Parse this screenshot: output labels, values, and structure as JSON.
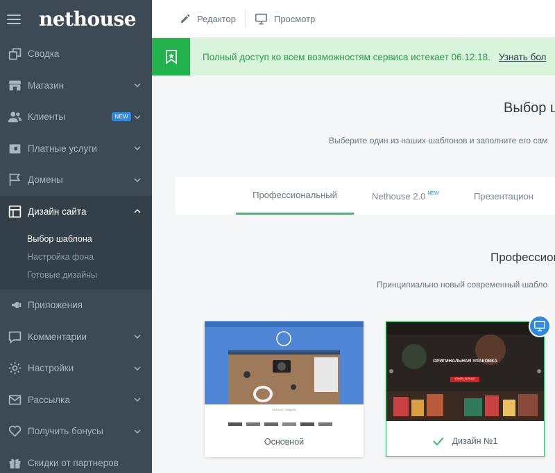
{
  "app": {
    "logo": "nethouse"
  },
  "sidebar": {
    "items": [
      {
        "label": "Сводка",
        "icon": "copy-icon"
      },
      {
        "label": "Магазин",
        "icon": "store-icon"
      },
      {
        "label": "Клиенты",
        "icon": "users-icon",
        "badge": "NEW"
      },
      {
        "label": "Платные услуги",
        "icon": "wallet-icon"
      },
      {
        "label": "Домены",
        "icon": "flag-icon"
      },
      {
        "label": "Дизайн сайта",
        "icon": "layout-icon"
      },
      {
        "label": "Приложения",
        "icon": "plug-icon"
      },
      {
        "label": "Комментарии",
        "icon": "comment-icon"
      },
      {
        "label": "Настройки",
        "icon": "gear-icon"
      },
      {
        "label": "Рассылка",
        "icon": "mail-icon"
      },
      {
        "label": "Получить бонусы",
        "icon": "heart-icon"
      },
      {
        "label": "Скидки от партнеров",
        "icon": "gift-icon"
      }
    ],
    "design_submenu": [
      "Выбор шаблона",
      "Настройка фона",
      "Готовые дизайны"
    ]
  },
  "topbar": {
    "editor_label": "Редактор",
    "preview_label": "Просмотр"
  },
  "banner": {
    "text": "Полный доступ ко всем возможностям сервиса истекает 06.12.18.",
    "link": "Узнать бол"
  },
  "main": {
    "title": "Выбор ш",
    "subtitle": "Выберите один из наших шаблонов и заполните его сам",
    "tabs": [
      {
        "label": "Профессиональный"
      },
      {
        "label": "Nethouse 2.0",
        "badge": "NEW"
      },
      {
        "label": "Презентацион"
      }
    ],
    "section_title": "Профессион",
    "section_subtitle": "Принципиально новый современный шабло",
    "cards": [
      {
        "caption": "Основной",
        "catalog_text": "Каталог товаров"
      },
      {
        "caption": "Дизайн №1",
        "hero_text": "ОРИГИНАЛЬНАЯ УПАКОВКА",
        "hero_button": "УЗНАТЬ БОЛЬШЕ"
      }
    ]
  },
  "colors": {
    "sidebar_bg": "#3c4a56",
    "accent_green": "#21b24b",
    "banner_bg": "#d8f5dc",
    "badge_blue": "#2d8ae0"
  }
}
